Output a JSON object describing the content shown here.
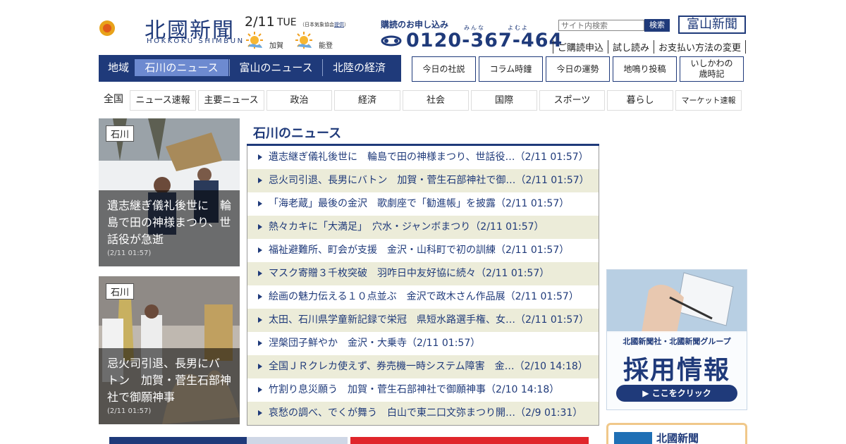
{
  "header": {
    "logo_text": "北國新聞",
    "logo_sub": "HOKKOKU SHIMBUN",
    "weather": {
      "date": "2/11",
      "dow": "TUE",
      "note_prefix": "（日本気象協会",
      "note_link": "提供",
      "note_suffix": "）",
      "locations": [
        {
          "name": "加賀",
          "icon": "sun-icon"
        },
        {
          "name": "能登",
          "icon": "sun-icon"
        }
      ]
    },
    "subscription": {
      "label": "購読のお申し込み",
      "kana_1": "みんな",
      "kana_2": "よむよ",
      "phone": "0120-367-464",
      "phone_icon": "free-dial-icon"
    },
    "search": {
      "placeholder": "サイト内検索",
      "button": "検索"
    },
    "toyama_link": "富山新聞",
    "sub_links": [
      "ご購読申込",
      "試し読み",
      "お支払い方法の変更"
    ]
  },
  "region_nav": {
    "label": "地域",
    "tabs": [
      {
        "label": "石川のニュース",
        "active": true
      },
      {
        "label": "富山のニュース",
        "active": false
      },
      {
        "label": "北陸の経済",
        "active": false
      }
    ]
  },
  "feature_buttons": [
    "今日の社説",
    "コラム時鐘",
    "今日の運勢",
    "地鳴り投稿",
    "いしかわの歳時記"
  ],
  "feature_two_line": {
    "line1": "いしかわの",
    "line2": "歳時記"
  },
  "categories": [
    "全国",
    "ニュース速報",
    "主要ニュース",
    "政治",
    "経済",
    "社会",
    "国際",
    "スポーツ",
    "暮らし",
    "マーケット速報"
  ],
  "photo_cards": [
    {
      "tag": "石川",
      "title": "遺志継ぎ儀礼後世に　輪島で田の神様まつり、世話役が急逝",
      "time": "(2/11 01:57)"
    },
    {
      "tag": "石川",
      "title": "忌火司引退、長男にバトン　加賀・菅生石部神社で御願神事",
      "time": "(2/11 01:57)"
    }
  ],
  "news": {
    "heading": "石川のニュース",
    "items": [
      "遺志継ぎ儀礼後世に　輪島で田の神様まつり、世話役…（2/11 01:57）",
      "忌火司引退、長男にバトン　加賀・菅生石部神社で御…（2/11 01:57）",
      "「海老蔵」最後の金沢　歌劇座で「勧進帳」を披露（2/11 01:57）",
      "熱々カキに「大満足」　穴水・ジャンボまつり（2/11 01:57）",
      "福祉避難所、町会が支援　金沢・山科町で初の訓練（2/11 01:57）",
      "マスク寄贈３千枚突破　羽咋日中友好協に続々（2/11 01:57）",
      "絵画の魅力伝える１０点並ぶ　金沢で政木さん作品展（2/11 01:57）",
      "太田、石川県学童新記録で栄冠　県短水路選手権、女…（2/11 01:57）",
      "涅槃団子鮮やか　金沢・大乗寺（2/11 01:57）",
      "全国ＪＲクレカ使えず、券売機一時システム障害　金…（2/10 14:18）",
      "竹割り息災願う　加賀・菅生石部神社で御願神事（2/10 14:18）",
      "哀愁の調べ、でくが舞う　白山で東二口文弥まつり開…（2/9 01:31）"
    ]
  },
  "banner": {
    "line1": "北國新聞社・北國新聞グループ",
    "line2": "採用情報",
    "button": "▶ ここをクリック"
  },
  "news_box": {
    "title": "北國新聞"
  },
  "colors": {
    "brand": "#1f3a7a",
    "active_tab": "#6d8ad0",
    "row_alt": "#ececd9",
    "banner_border": "#f0c88a"
  }
}
